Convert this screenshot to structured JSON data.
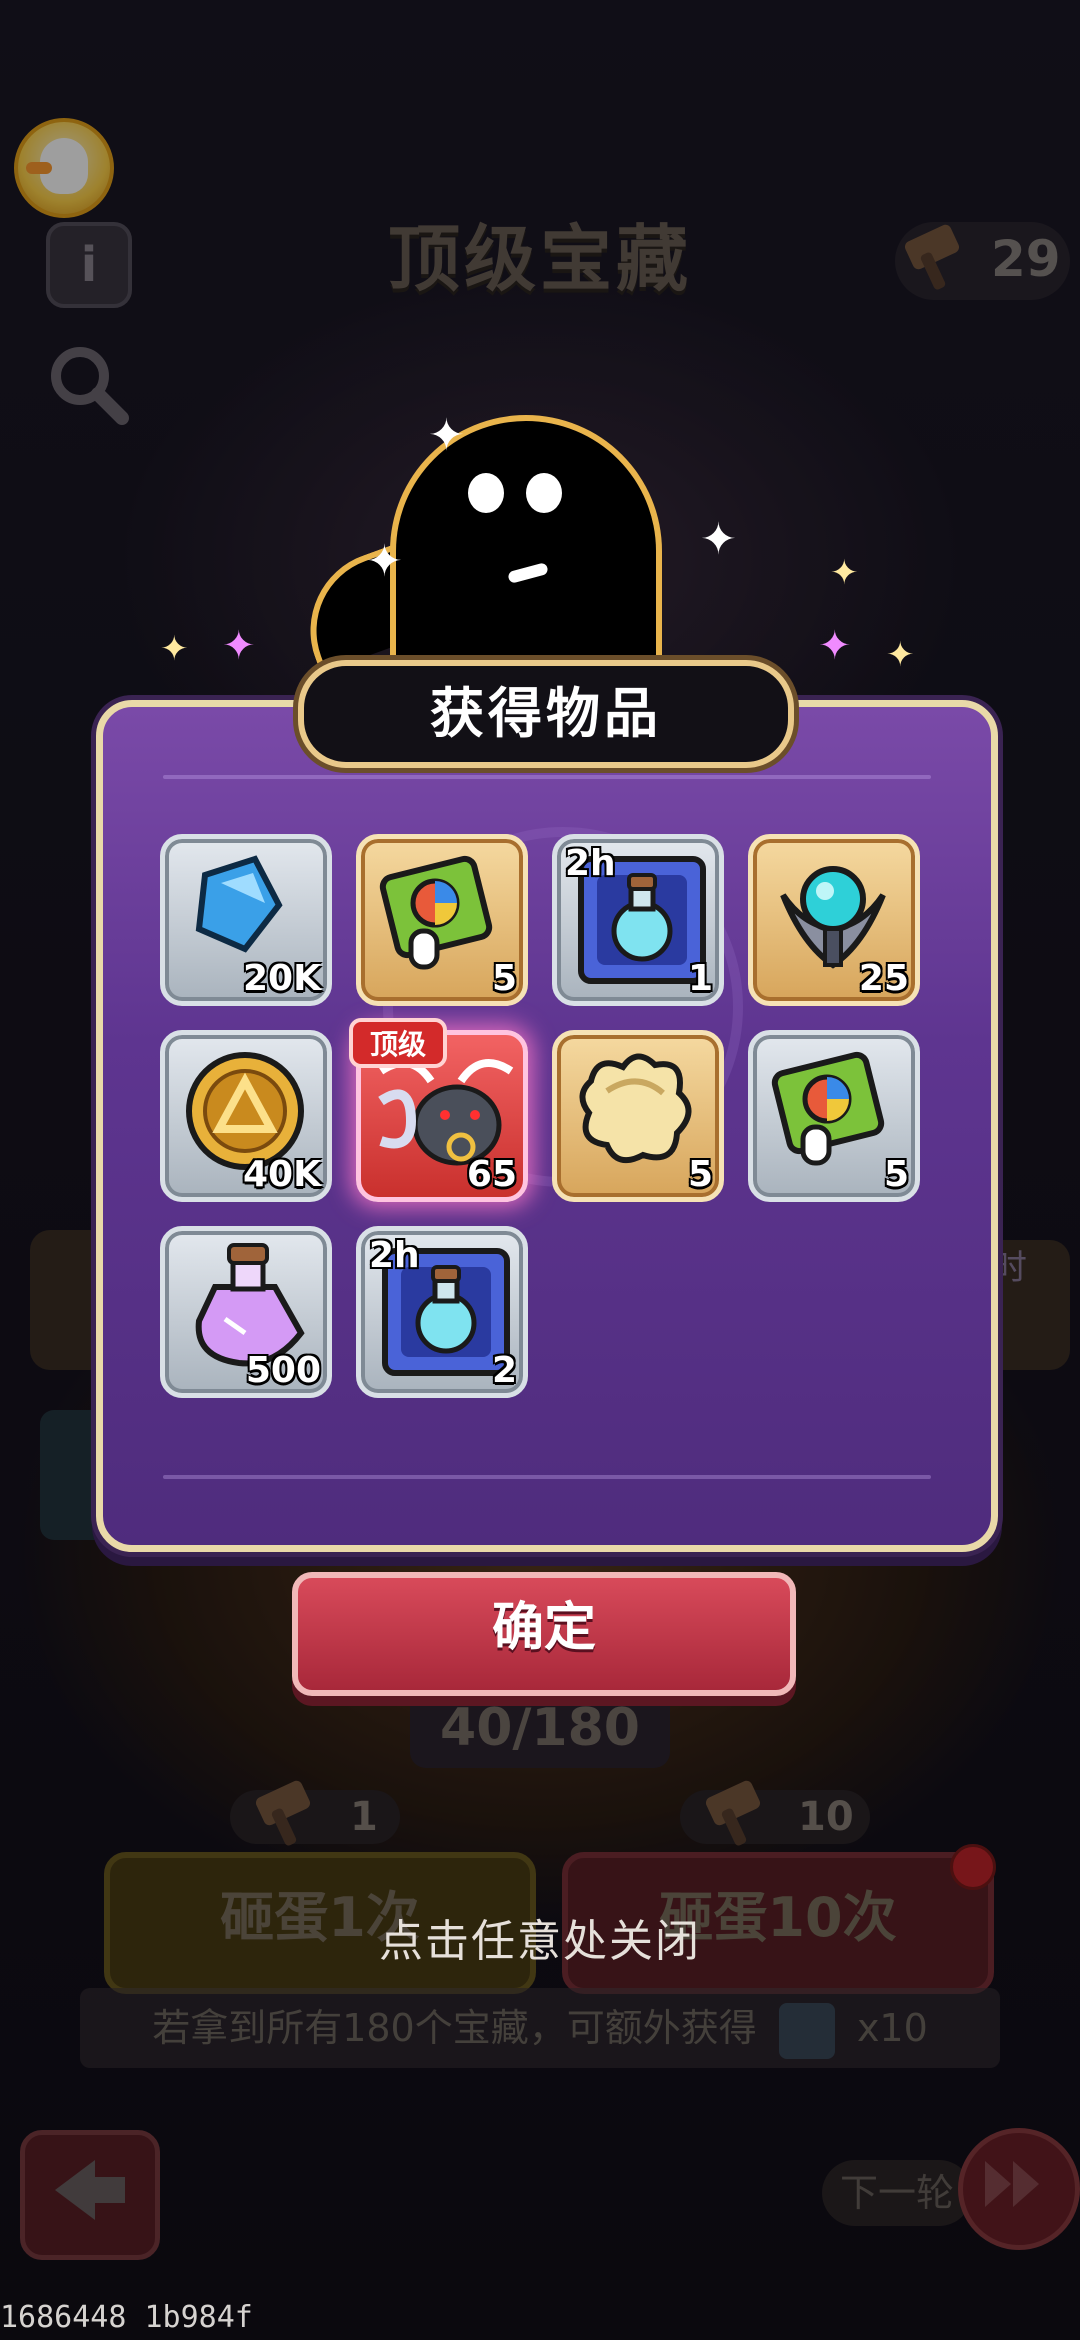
{
  "background": {
    "title": "顶级宝藏",
    "hammer_count": "29",
    "progress": "40/180",
    "smash_once": {
      "cost": "1",
      "label": "砸蛋1次"
    },
    "smash_ten": {
      "cost": "10",
      "label": "砸蛋10次"
    },
    "timer_text": "11天4小时",
    "reward_line": "若拿到所有180个宝藏，可额外获得",
    "reward_multiplier": "x10",
    "next_round": "下一轮"
  },
  "dialog": {
    "title": "获得物品",
    "items": [
      {
        "icon": "blue-crystal-icon",
        "frame": "silver",
        "qty": "20K"
      },
      {
        "icon": "skill-book-icon",
        "frame": "gold",
        "qty": "5"
      },
      {
        "icon": "potion-scroll-icon",
        "frame": "silver",
        "qty": "1",
        "badge": "2h"
      },
      {
        "icon": "blue-orb-emblem-icon",
        "frame": "gold",
        "qty": "25"
      },
      {
        "icon": "gold-coin-icon",
        "frame": "silver",
        "qty": "40K"
      },
      {
        "icon": "bull-hero-shard-icon",
        "frame": "red",
        "qty": "65",
        "tag": "顶级"
      },
      {
        "icon": "cream-puzzle-piece-icon",
        "frame": "gold",
        "qty": "5"
      },
      {
        "icon": "skill-book-icon",
        "frame": "silver",
        "qty": "5"
      },
      {
        "icon": "pink-potion-icon",
        "frame": "silver",
        "qty": "500"
      },
      {
        "icon": "potion-scroll-icon",
        "frame": "silver",
        "qty": "2",
        "badge": "2h"
      }
    ],
    "confirm_label": "确定",
    "close_hint": "点击任意处关闭"
  },
  "footer_id": "1686448 1b984f",
  "colors": {
    "panel": "#5e3590",
    "confirm": "#c23a4c",
    "rare_frame": "#e04545"
  }
}
